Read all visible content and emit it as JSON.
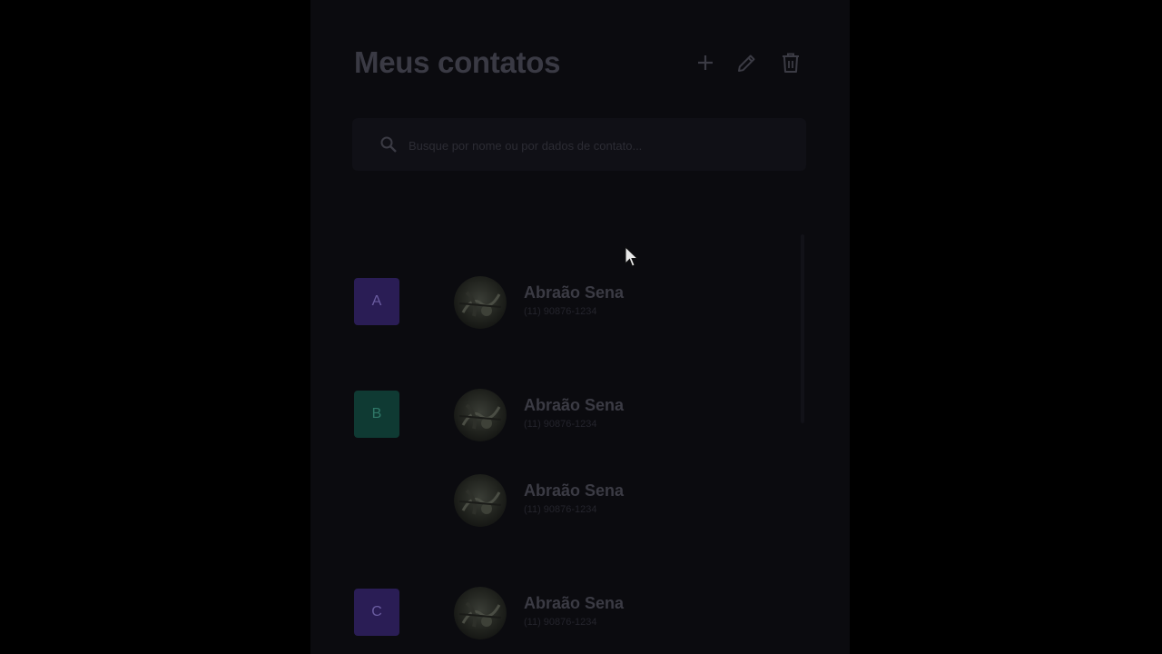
{
  "header": {
    "title": "Meus contatos",
    "add_icon": "plus-icon",
    "edit_icon": "pencil-icon",
    "delete_icon": "trash-icon"
  },
  "search": {
    "placeholder": "Busque por nome ou por dados de contato...",
    "value": "",
    "icon": "search-icon"
  },
  "groups": [
    {
      "letter": "A",
      "color": "#2a1d55",
      "text_color": "#6a5ca0",
      "contacts": [
        {
          "name": "Abraão Sena",
          "phone": "(11) 90876-1234"
        }
      ]
    },
    {
      "letter": "B",
      "color": "#0f3a33",
      "text_color": "#2f7868",
      "contacts": [
        {
          "name": "Abraão Sena",
          "phone": "(11) 90876-1234"
        },
        {
          "name": "Abraão Sena",
          "phone": "(11) 90876-1234"
        }
      ]
    },
    {
      "letter": "C",
      "color": "#2a1d55",
      "text_color": "#6a5ca0",
      "contacts": [
        {
          "name": "Abraão Sena",
          "phone": "(11) 90876-1234"
        }
      ]
    }
  ],
  "colors": {
    "background": "#0b0b0f",
    "overlay": "#000000",
    "text_muted": "#3a3a44"
  }
}
